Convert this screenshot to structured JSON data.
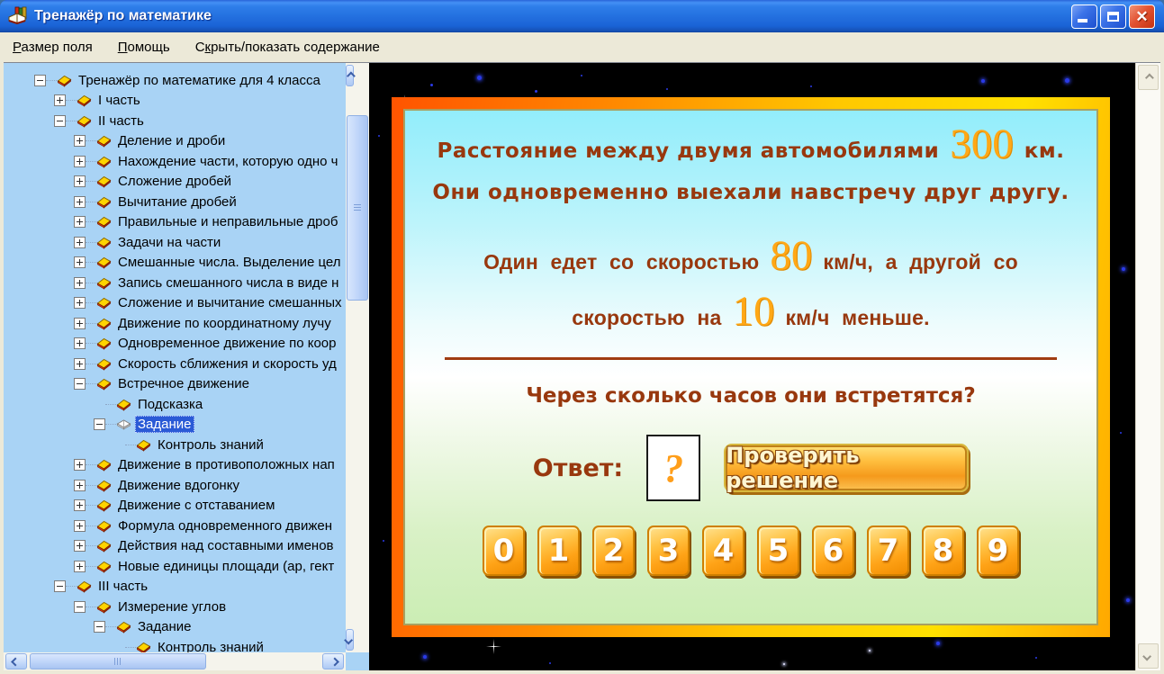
{
  "window": {
    "title": "Тренажёр по математике"
  },
  "menu": {
    "items": [
      {
        "pre": "",
        "hotkey": "Р",
        "post": "азмер поля"
      },
      {
        "pre": "",
        "hotkey": "П",
        "post": "омощь"
      },
      {
        "pre": "С",
        "hotkey": "к",
        "post": "рыть/показать содержание"
      }
    ]
  },
  "sidebar": {
    "tree": [
      {
        "label": "Тренажёр по математике для 4 класса",
        "level": 0,
        "expand": "minus",
        "icon": "book-closed"
      },
      {
        "label": "I часть",
        "level": 1,
        "expand": "plus",
        "icon": "book-closed"
      },
      {
        "label": "II часть",
        "level": 1,
        "expand": "minus",
        "icon": "book-closed"
      },
      {
        "label": "Деление и дроби",
        "level": 2,
        "expand": "plus",
        "icon": "book-closed"
      },
      {
        "label": "Нахождение части, которую одно ч",
        "level": 2,
        "expand": "plus",
        "icon": "book-closed"
      },
      {
        "label": "Сложение дробей",
        "level": 2,
        "expand": "plus",
        "icon": "book-closed"
      },
      {
        "label": "Вычитание дробей",
        "level": 2,
        "expand": "plus",
        "icon": "book-closed"
      },
      {
        "label": "Правильные и неправильные дроб",
        "level": 2,
        "expand": "plus",
        "icon": "book-closed"
      },
      {
        "label": "Задачи на части",
        "level": 2,
        "expand": "plus",
        "icon": "book-closed"
      },
      {
        "label": "Смешанные числа. Выделение цел",
        "level": 2,
        "expand": "plus",
        "icon": "book-closed"
      },
      {
        "label": "Запись смешанного числа в виде н",
        "level": 2,
        "expand": "plus",
        "icon": "book-closed"
      },
      {
        "label": "Сложение и вычитание смешанных",
        "level": 2,
        "expand": "plus",
        "icon": "book-closed"
      },
      {
        "label": "Движение по координатному лучу",
        "level": 2,
        "expand": "plus",
        "icon": "book-closed"
      },
      {
        "label": "Одновременное движение по коор",
        "level": 2,
        "expand": "plus",
        "icon": "book-closed"
      },
      {
        "label": "Скорость сближения и скорость уд",
        "level": 2,
        "expand": "plus",
        "icon": "book-closed"
      },
      {
        "label": "Встречное движение",
        "level": 2,
        "expand": "minus",
        "icon": "book-closed"
      },
      {
        "label": "Подсказка",
        "level": 3,
        "expand": "none",
        "icon": "book-closed"
      },
      {
        "label": "Задание",
        "level": 3,
        "expand": "minus",
        "icon": "book-open",
        "selected": true
      },
      {
        "label": "Контроль знаний",
        "level": 4,
        "expand": "none",
        "icon": "book-closed"
      },
      {
        "label": "Движение в противоположных нап",
        "level": 2,
        "expand": "plus",
        "icon": "book-closed"
      },
      {
        "label": "Движение вдогонку",
        "level": 2,
        "expand": "plus",
        "icon": "book-closed"
      },
      {
        "label": "Движение с отставанием",
        "level": 2,
        "expand": "plus",
        "icon": "book-closed"
      },
      {
        "label": "Формула одновременного движен",
        "level": 2,
        "expand": "plus",
        "icon": "book-closed"
      },
      {
        "label": "Действия над составными именов",
        "level": 2,
        "expand": "plus",
        "icon": "book-closed"
      },
      {
        "label": "Новые единицы площади (ар, гект",
        "level": 2,
        "expand": "plus",
        "icon": "book-closed"
      },
      {
        "label": "III часть",
        "level": 1,
        "expand": "minus",
        "icon": "book-closed"
      },
      {
        "label": "Измерение углов",
        "level": 2,
        "expand": "minus",
        "icon": "book-closed"
      },
      {
        "label": "Задание",
        "level": 3,
        "expand": "minus",
        "icon": "book-closed"
      },
      {
        "label": "Контроль знаний",
        "level": 4,
        "expand": "none",
        "icon": "book-closed"
      }
    ]
  },
  "problem": {
    "line1": {
      "pre": "Расстояние между двумя автомобилями",
      "number": "300",
      "post": "км."
    },
    "line2": {
      "text": "Они одновременно выехали навстречу друг другу."
    },
    "line3": {
      "pre": "Один едет со скоростью",
      "number": "80",
      "post": "км/ч, а другой со"
    },
    "line4": {
      "pre": "скоростью на",
      "number": "10",
      "post": "км/ч меньше."
    },
    "question": "Через сколько часов они встретятся?"
  },
  "answer": {
    "label": "Ответ:",
    "value": "?",
    "check_button_label": "Проверить решение",
    "digits": [
      "0",
      "1",
      "2",
      "3",
      "4",
      "5",
      "6",
      "7",
      "8",
      "9"
    ]
  },
  "colors": {
    "selection_blue": "#2a5ad6",
    "tree_background": "#a9d3f5",
    "card_border_orange": "#ff8a00",
    "problem_text_brown": "#98380e",
    "number_orange": "#ffa816",
    "button_gold": "#ffbe3e"
  }
}
